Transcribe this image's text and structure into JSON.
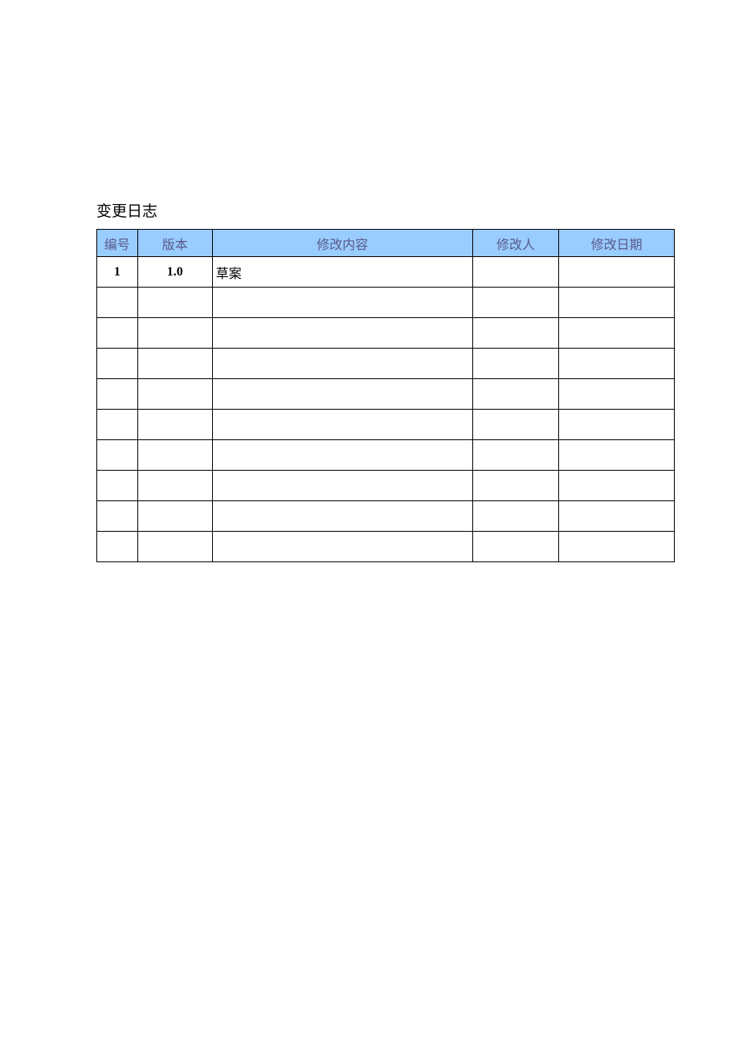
{
  "title": "变更日志",
  "colors": {
    "header_bg": "#99ccff",
    "header_text": "#5a5a8a",
    "border": "#000000"
  },
  "table": {
    "headers": {
      "id": "编号",
      "version": "版本",
      "content": "修改内容",
      "author": "修改人",
      "date": "修改日期"
    },
    "rows": [
      {
        "id": "1",
        "version": "1.0",
        "content": "草案",
        "author": "",
        "date": ""
      },
      {
        "id": "",
        "version": "",
        "content": "",
        "author": "",
        "date": ""
      },
      {
        "id": "",
        "version": "",
        "content": "",
        "author": "",
        "date": ""
      },
      {
        "id": "",
        "version": "",
        "content": "",
        "author": "",
        "date": ""
      },
      {
        "id": "",
        "version": "",
        "content": "",
        "author": "",
        "date": ""
      },
      {
        "id": "",
        "version": "",
        "content": "",
        "author": "",
        "date": ""
      },
      {
        "id": "",
        "version": "",
        "content": "",
        "author": "",
        "date": ""
      },
      {
        "id": "",
        "version": "",
        "content": "",
        "author": "",
        "date": ""
      },
      {
        "id": "",
        "version": "",
        "content": "",
        "author": "",
        "date": ""
      },
      {
        "id": "",
        "version": "",
        "content": "",
        "author": "",
        "date": ""
      }
    ]
  }
}
